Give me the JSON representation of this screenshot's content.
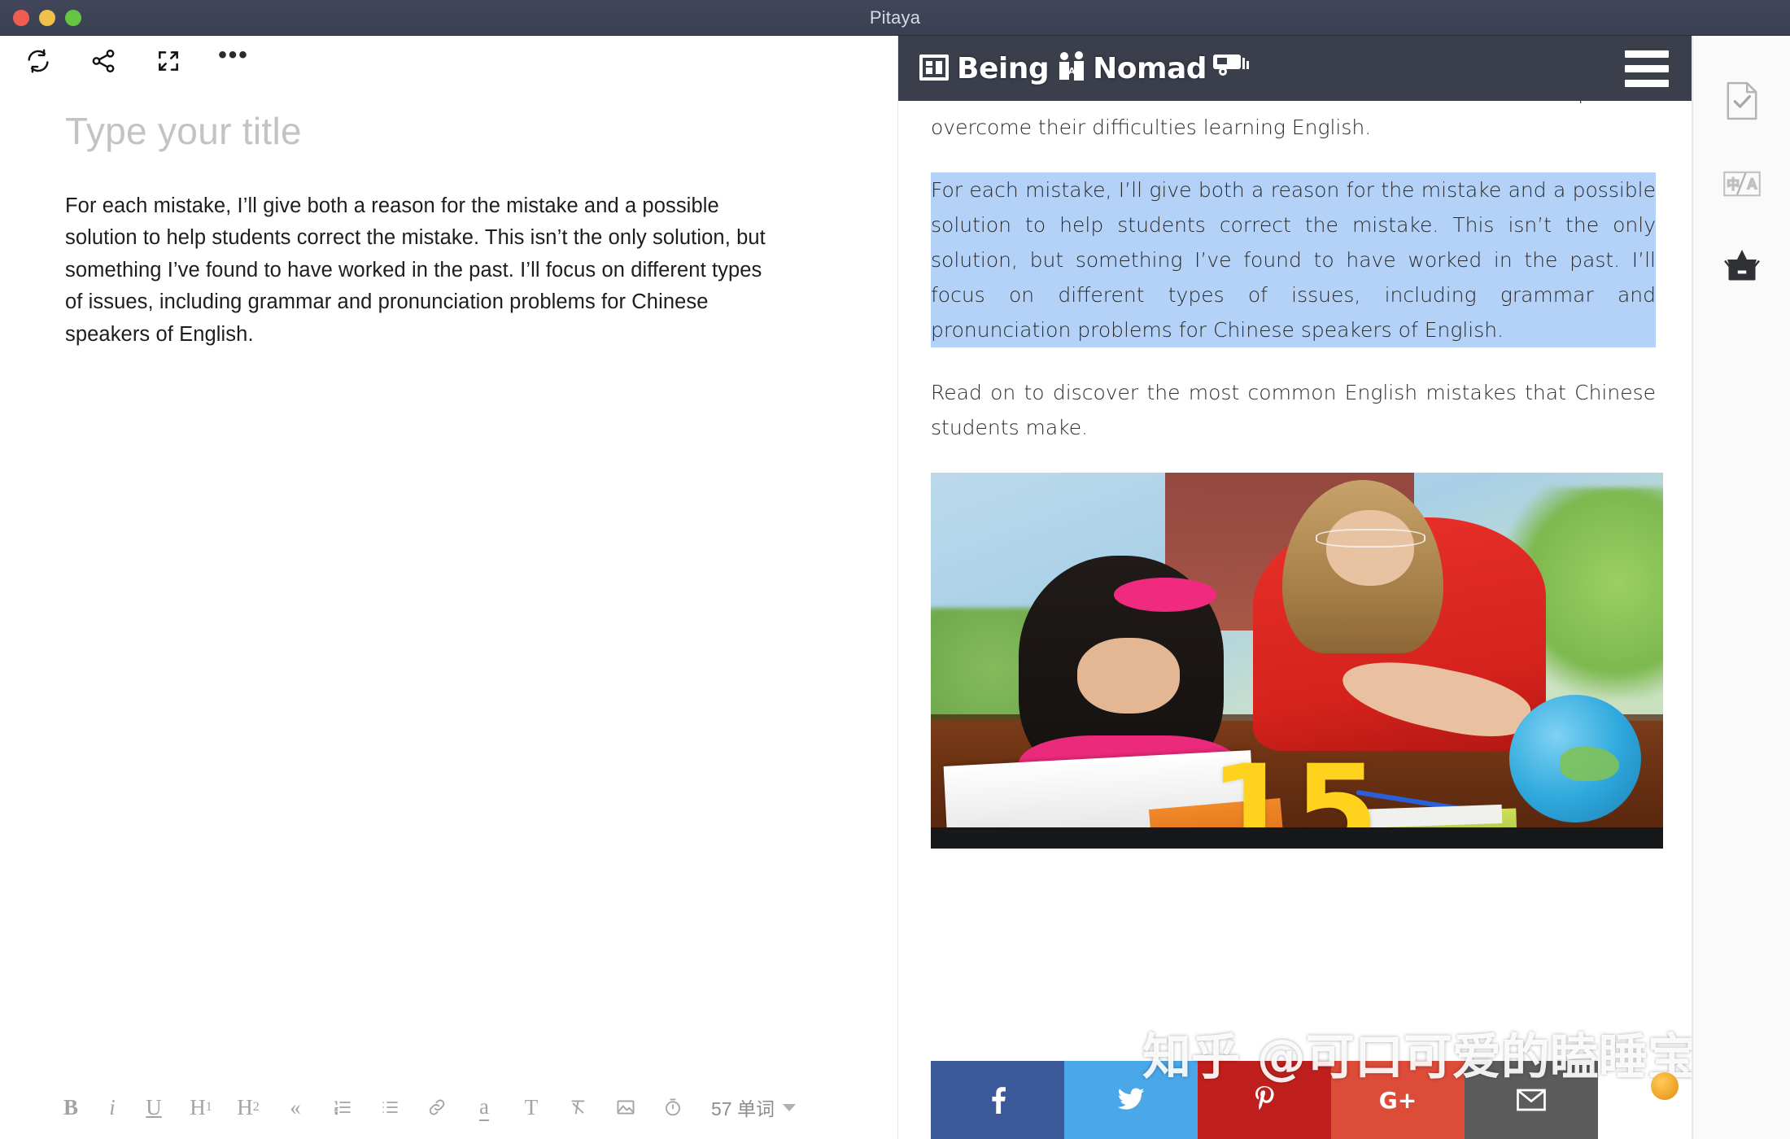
{
  "window": {
    "title": "Pitaya",
    "controls": {
      "close": "close",
      "minimize": "minimize",
      "zoom": "zoom"
    }
  },
  "editor_toolbar": {
    "items": [
      {
        "name": "sync-icon",
        "label": "Sync"
      },
      {
        "name": "share-icon",
        "label": "Share"
      },
      {
        "name": "fullscreen-icon",
        "label": "Fullscreen"
      },
      {
        "name": "more-icon",
        "label": "More"
      }
    ],
    "more_glyph": "•••"
  },
  "editor": {
    "title_placeholder": "Type your title",
    "paragraph": "For each mistake, I’ll give both a reason for the mistake and a possible solution to help students correct the mistake. This isn’t the only solution, but something I’ve found to have worked in the past. I’ll focus on different types of issues, including grammar and pronunciation problems for Chinese speakers of English."
  },
  "format_bar": {
    "bold": "B",
    "italic": "i",
    "underline": "U",
    "heading1": "H",
    "heading1_sub": "1",
    "heading2": "H",
    "heading2_sub": "2",
    "quote": "«",
    "ordered_list": "ordered-list",
    "unordered_list": "unordered-list",
    "link": "link",
    "highlight": "a",
    "text_style": "T",
    "clear_format": "clear-format",
    "image": "image",
    "timer": "timer",
    "word_count": "57 单词"
  },
  "preview": {
    "site_header": {
      "brand": "Being",
      "brand2": "Nomad",
      "menu": "menu"
    },
    "paragraph_top": "… to Chinese students. But students can use it well to help them overcome their difficulties learning English.",
    "paragraph_selected": "For each mistake, I’ll give both a reason for the mistake and a possible solution to help students correct the mistake. This isn’t the only solution, but something I’ve found to have worked in the past. I’ll focus on different types of issues, including grammar and pronunciation problems for Chinese speakers of English.",
    "paragraph_after": "Read on to discover the most common English mistakes that Chinese students make.",
    "figure": {
      "overlay_number": "15",
      "alt": "Teacher helping a young student with homework at a desk"
    },
    "social_buttons": [
      {
        "name": "facebook-share-button",
        "label": "f",
        "color": "#3b5998"
      },
      {
        "name": "twitter-share-button",
        "label": "t",
        "color": "#4aa7e8"
      },
      {
        "name": "pinterest-share-button",
        "label": "p",
        "color": "#c0201d"
      },
      {
        "name": "googleplus-share-button",
        "label": "G+",
        "color": "#dd4b39"
      },
      {
        "name": "email-share-button",
        "label": "✉",
        "color": "#5c5c5c"
      }
    ],
    "watermark": "知乎 @可口可爱的瞌睡宝宝"
  },
  "right_rail": {
    "items": [
      {
        "name": "document-check-icon",
        "label": "Proofread"
      },
      {
        "name": "translate-icon",
        "label": "Translate"
      },
      {
        "name": "archive-box-icon",
        "label": "Archive"
      }
    ]
  },
  "colors": {
    "titlebar": "#3b3f52",
    "selection": "#b4d2f7",
    "site_header": "#3b3f4c",
    "accent_yellow": "#ffd21e"
  }
}
